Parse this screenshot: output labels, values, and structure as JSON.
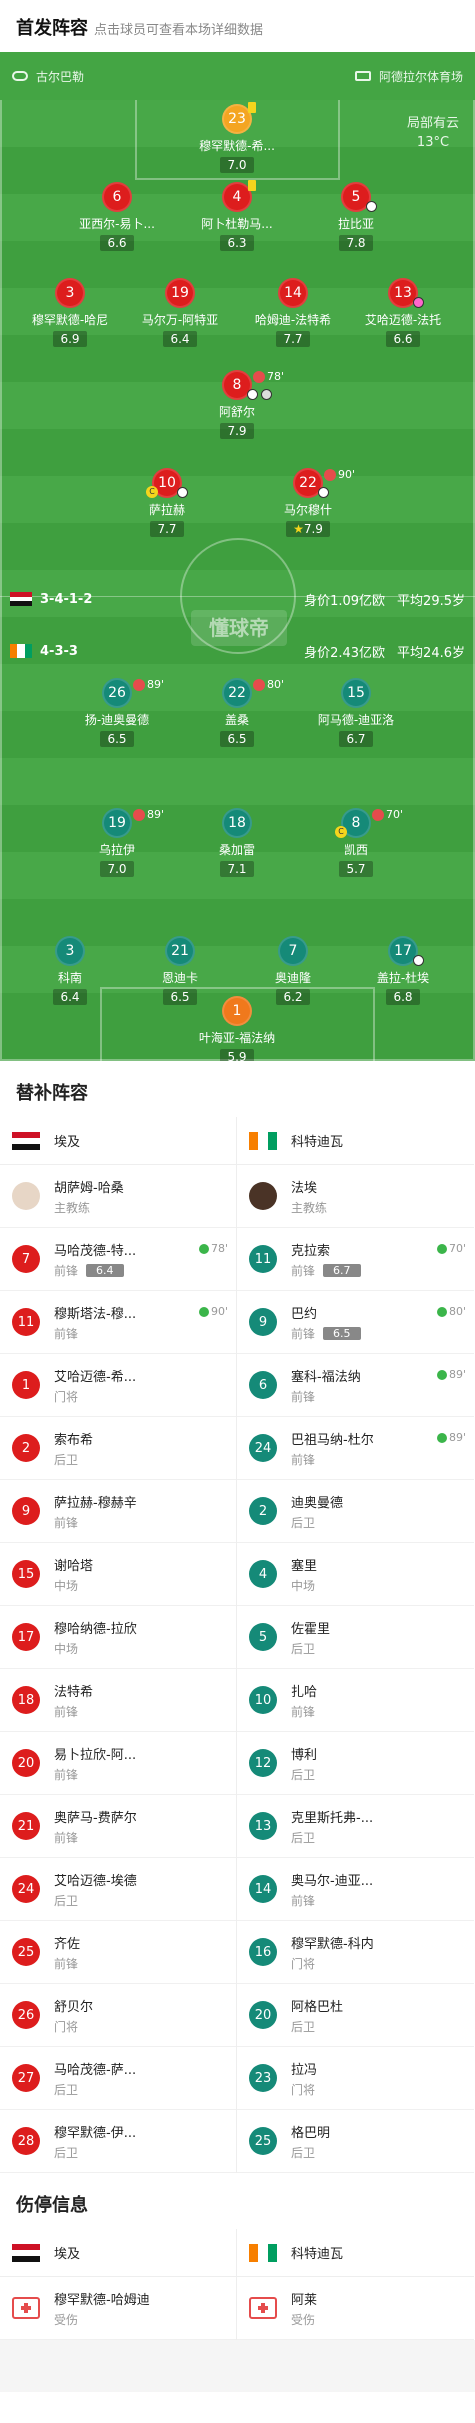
{
  "header": {
    "title": "首发阵容",
    "subtitle": "点击球员可查看本场详细数据"
  },
  "pitch_top": {
    "left": "古尔巴勒",
    "right": "阿德拉尔体育场"
  },
  "weather": {
    "text": "局部有云",
    "temp": "13°C"
  },
  "watermark": "懂球帝",
  "colors": {
    "egypt_red": "#dd1d1d",
    "ivory_teal": "#158a78",
    "pitch_green": "#3f9f3f"
  },
  "egypt_lineup": [
    {
      "num": "23",
      "name": "穆罕默德-希...",
      "rating": "7.0",
      "yellow": true
    },
    {
      "num": "6",
      "name": "亚西尔-易卜...",
      "rating": "6.6"
    },
    {
      "num": "4",
      "name": "阿卜杜勒马...",
      "rating": "6.3",
      "yellow": true
    },
    {
      "num": "5",
      "name": "拉比亚",
      "rating": "7.8",
      "ball": true
    },
    {
      "num": "3",
      "name": "穆罕默德-哈尼",
      "rating": "6.9"
    },
    {
      "num": "19",
      "name": "马尔万-阿特亚",
      "rating": "6.4"
    },
    {
      "num": "14",
      "name": "哈姆迪-法特希",
      "rating": "7.7"
    },
    {
      "num": "13",
      "name": "艾哈迈德-法托",
      "rating": "6.6"
    },
    {
      "num": "8",
      "name": "阿舒尔",
      "rating": "7.9",
      "sub": "78'"
    },
    {
      "num": "10",
      "name": "萨拉赫",
      "rating": "7.7",
      "captain": true,
      "ball": true
    },
    {
      "num": "22",
      "name": "马尔穆什",
      "rating": "7.9",
      "sub": "90'",
      "star": true
    }
  ],
  "egypt_form": {
    "formation": "3-4-1-2",
    "value": "身价1.09亿欧",
    "age": "平均29.5岁"
  },
  "ivory_form": {
    "formation": "4-3-3",
    "value": "身价2.43亿欧",
    "age": "平均24.6岁"
  },
  "ivory_lineup": [
    {
      "num": "26",
      "name": "扬-迪奥曼德",
      "rating": "6.5",
      "sub": "89'"
    },
    {
      "num": "22",
      "name": "盖桑",
      "rating": "6.5",
      "sub": "80'"
    },
    {
      "num": "15",
      "name": "阿马德-迪亚洛",
      "rating": "6.7"
    },
    {
      "num": "19",
      "name": "乌拉伊",
      "rating": "7.0",
      "sub": "89'"
    },
    {
      "num": "18",
      "name": "桑加雷",
      "rating": "7.1"
    },
    {
      "num": "8",
      "name": "凯西",
      "rating": "5.7",
      "sub": "70'",
      "captain": true
    },
    {
      "num": "3",
      "name": "科南",
      "rating": "6.4"
    },
    {
      "num": "21",
      "name": "恩迪卡",
      "rating": "6.5"
    },
    {
      "num": "7",
      "name": "奥迪隆",
      "rating": "6.2"
    },
    {
      "num": "17",
      "name": "盖拉-杜埃",
      "rating": "6.8",
      "ball": true
    },
    {
      "num": "1",
      "name": "叶海亚-福法纳",
      "rating": "5.9"
    }
  ],
  "subs": {
    "title": "替补阵容",
    "left_team": "埃及",
    "right_team": "科特迪瓦",
    "left": [
      {
        "name": "胡萨姆-哈桑",
        "pos": "主教练",
        "coach": true
      },
      {
        "num": "7",
        "name": "马哈茂德-特...",
        "pos": "前锋",
        "rating": "6.4",
        "sub": "78'"
      },
      {
        "num": "11",
        "name": "穆斯塔法-穆...",
        "pos": "前锋",
        "sub": "90'"
      },
      {
        "num": "1",
        "name": "艾哈迈德-希...",
        "pos": "门将"
      },
      {
        "num": "2",
        "name": "索布希",
        "pos": "后卫"
      },
      {
        "num": "9",
        "name": "萨拉赫-穆赫辛",
        "pos": "前锋"
      },
      {
        "num": "15",
        "name": "谢哈塔",
        "pos": "中场"
      },
      {
        "num": "17",
        "name": "穆哈纳德-拉欣",
        "pos": "中场"
      },
      {
        "num": "18",
        "name": "法特希",
        "pos": "前锋"
      },
      {
        "num": "20",
        "name": "易卜拉欣-阿...",
        "pos": "前锋"
      },
      {
        "num": "21",
        "name": "奥萨马-费萨尔",
        "pos": "前锋"
      },
      {
        "num": "24",
        "name": "艾哈迈德-埃德",
        "pos": "后卫"
      },
      {
        "num": "25",
        "name": "齐佐",
        "pos": "前锋"
      },
      {
        "num": "26",
        "name": "舒贝尔",
        "pos": "门将"
      },
      {
        "num": "27",
        "name": "马哈茂德-萨...",
        "pos": "后卫"
      },
      {
        "num": "28",
        "name": "穆罕默德-伊...",
        "pos": "后卫"
      }
    ],
    "right": [
      {
        "name": "法埃",
        "pos": "主教练",
        "coach": true
      },
      {
        "num": "11",
        "name": "克拉索",
        "pos": "前锋",
        "rating": "6.7",
        "sub": "70'"
      },
      {
        "num": "9",
        "name": "巴约",
        "pos": "前锋",
        "rating": "6.5",
        "sub": "80'"
      },
      {
        "num": "6",
        "name": "塞科-福法纳",
        "pos": "前锋",
        "sub": "89'"
      },
      {
        "num": "24",
        "name": "巴祖马纳-杜尔",
        "pos": "前锋",
        "sub": "89'"
      },
      {
        "num": "2",
        "name": "迪奥曼德",
        "pos": "后卫"
      },
      {
        "num": "4",
        "name": "塞里",
        "pos": "中场"
      },
      {
        "num": "5",
        "name": "佐霍里",
        "pos": "后卫"
      },
      {
        "num": "10",
        "name": "扎哈",
        "pos": "前锋"
      },
      {
        "num": "12",
        "name": "博利",
        "pos": "后卫"
      },
      {
        "num": "13",
        "name": "克里斯托弗-...",
        "pos": "后卫"
      },
      {
        "num": "14",
        "name": "奥马尔-迪亚...",
        "pos": "前锋"
      },
      {
        "num": "16",
        "name": "穆罕默德-科内",
        "pos": "门将"
      },
      {
        "num": "20",
        "name": "阿格巴杜",
        "pos": "后卫"
      },
      {
        "num": "23",
        "name": "拉冯",
        "pos": "门将"
      },
      {
        "num": "25",
        "name": "格巴明",
        "pos": "后卫"
      }
    ]
  },
  "injury": {
    "title": "伤停信息",
    "left_team": "埃及",
    "right_team": "科特迪瓦",
    "left": {
      "name": "穆罕默德-哈姆迪",
      "status": "受伤"
    },
    "right": {
      "name": "阿莱",
      "status": "受伤"
    }
  }
}
